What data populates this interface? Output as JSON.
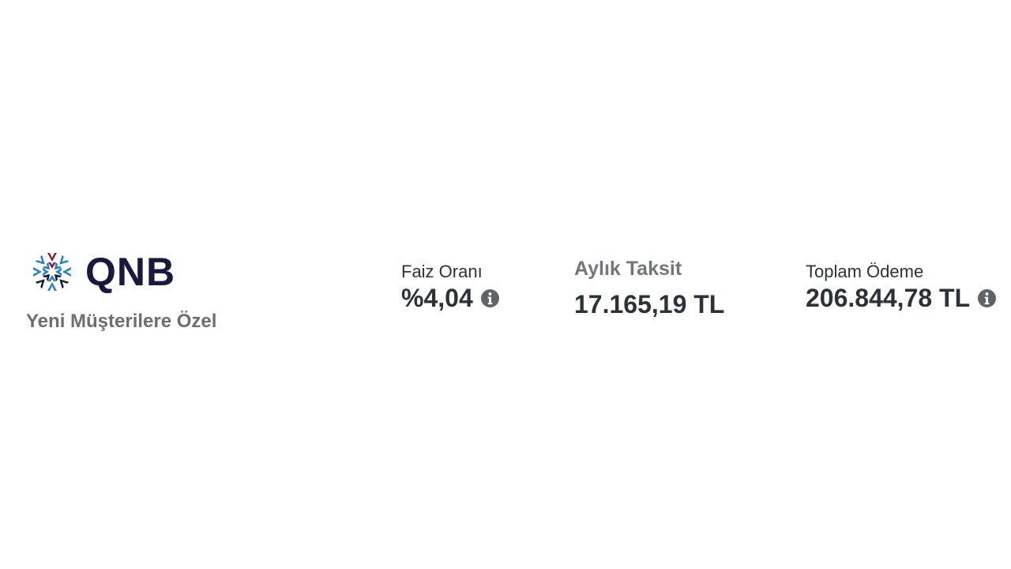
{
  "brand": {
    "name": "QNB",
    "tagline": "Yeni Müşterilere Özel",
    "colors": {
      "navy": "#171a3d",
      "blue": "#2a7ec2",
      "maroon": "#8a1f4b"
    }
  },
  "offer": {
    "rate": {
      "label": "Faiz Oranı",
      "value": "%4,04",
      "icon": "info-icon"
    },
    "monthly": {
      "label": "Aylık Taksit",
      "value": "17.165,19 TL"
    },
    "total": {
      "label": "Toplam Ödeme",
      "value": "206.844,78 TL",
      "icon": "info-icon"
    }
  }
}
